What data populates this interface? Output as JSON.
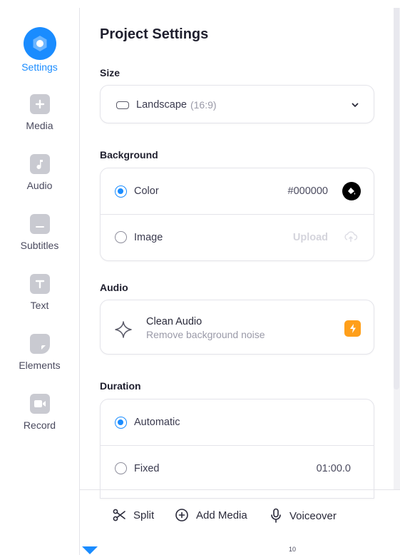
{
  "sidebar": {
    "items": [
      {
        "label": "Settings",
        "icon": "settings-icon",
        "active": true
      },
      {
        "label": "Media",
        "icon": "plus-icon",
        "active": false
      },
      {
        "label": "Audio",
        "icon": "music-note-icon",
        "active": false
      },
      {
        "label": "Subtitles",
        "icon": "subtitles-icon",
        "active": false
      },
      {
        "label": "Text",
        "icon": "text-icon",
        "active": false
      },
      {
        "label": "Elements",
        "icon": "sticker-icon",
        "active": false
      },
      {
        "label": "Record",
        "icon": "video-camera-icon",
        "active": false
      }
    ]
  },
  "panel": {
    "title": "Project Settings",
    "size": {
      "label": "Size",
      "selected": "Landscape",
      "ratio": "(16:9)"
    },
    "background": {
      "label": "Background",
      "options": [
        {
          "label": "Color",
          "value": "#000000",
          "checked": true
        },
        {
          "label": "Image",
          "value": "Upload",
          "checked": false
        }
      ],
      "color_swatch": "#000000"
    },
    "audio": {
      "label": "Audio",
      "feature_title": "Clean Audio",
      "feature_subtitle": "Remove background noise",
      "badge_color": "#ff9f1a"
    },
    "duration": {
      "label": "Duration",
      "options": [
        {
          "label": "Automatic",
          "checked": true
        },
        {
          "label": "Fixed",
          "value": "01:00.0",
          "checked": false
        }
      ]
    }
  },
  "toolbar": {
    "split_label": "Split",
    "add_media_label": "Add Media",
    "voiceover_label": "Voiceover"
  },
  "timeline": {
    "tick_label": "10"
  },
  "colors": {
    "accent": "#1a8cff"
  }
}
